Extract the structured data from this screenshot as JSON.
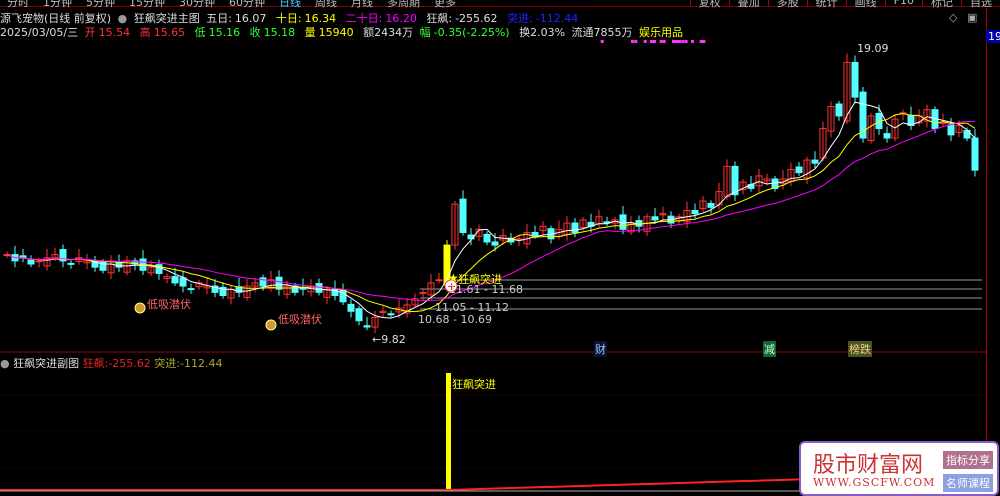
{
  "toolbar": {
    "tabs": [
      "分时",
      "1分钟",
      "5分钟",
      "15分钟",
      "30分钟",
      "60分钟",
      "日线",
      "周线",
      "月线",
      "多周期",
      "更多"
    ],
    "active": "日线",
    "right": [
      "复权",
      "叠加",
      "多股",
      "统计",
      "画线",
      "F10",
      "标记",
      "自选"
    ]
  },
  "header": {
    "stock": "源飞宠物(日线 前复权)",
    "indicator": "狂飙突进主图",
    "ma5_label": "五日:",
    "ma5": "16.07",
    "ma10_label": "十日:",
    "ma10": "16.34",
    "ma20_label": "二十日:",
    "ma20": "16.20",
    "kb_label": "狂飙:",
    "kb": "-255.62",
    "tj_label": "突进:",
    "tj": "-112.44"
  },
  "quote": {
    "date": "2025/03/05/三",
    "open_l": "开",
    "open": "15.54",
    "high_l": "高",
    "high": "15.65",
    "low_l": "低",
    "low": "15.16",
    "close_l": "收",
    "close": "15.18",
    "vol_l": "量",
    "vol": "15940",
    "amt": "额2434万",
    "chg_l": "幅",
    "chg": "-0.35(-2.25%)",
    "turn": "换2.03%",
    "float": "流通7855万",
    "sector": "娱乐用品"
  },
  "axis": {
    "top_price": "19.0"
  },
  "annotations": {
    "high": "19.09",
    "low": "←9.82",
    "signal": "狂飙突进",
    "r1": "11.61 - 11.68",
    "r2": "11.05 - 11.12",
    "r3": "10.68 - 10.69",
    "mark1": "低吸潜伏",
    "mark2": "低吸潜伏",
    "tag_cai": "财",
    "tag_jian": "减",
    "tag_bang": "榜跌"
  },
  "sub": {
    "title": "狂飙突进副图",
    "kb_label": "狂飙:",
    "kb": "-255.62",
    "tj_label": "突进:",
    "tj": "-112.44",
    "signal": "狂飙突进"
  },
  "watermark": {
    "title": "股市财富网",
    "url": "WWW.GSCFW.COM",
    "b1": "指标分享",
    "b2": "名师课程"
  },
  "colors": {
    "up": "#ff3232",
    "down": "#54ffff",
    "ma5": "#ffffff",
    "ma10": "#ffff00",
    "ma20": "#ff00ff"
  },
  "chart_data": {
    "type": "candlestick",
    "price_range": [
      9.82,
      19.09
    ],
    "closes": [
      12.5,
      12.3,
      12.4,
      12.2,
      12.3,
      12.4,
      12.5,
      12.3,
      12.2,
      12.4,
      12.3,
      12.1,
      12.0,
      12.2,
      12.1,
      12.3,
      12.2,
      12.0,
      12.1,
      11.9,
      11.8,
      11.6,
      11.5,
      11.4,
      11.6,
      11.5,
      11.3,
      11.2,
      11.4,
      11.3,
      11.5,
      11.6,
      11.5,
      11.7,
      11.4,
      11.5,
      11.3,
      11.4,
      11.5,
      11.3,
      11.4,
      11.2,
      11.0,
      10.7,
      10.4,
      10.2,
      10.5,
      10.7,
      10.6,
      10.8,
      10.9,
      11.1,
      11.3,
      11.6,
      11.7,
      12.8,
      14.1,
      13.2,
      13.0,
      13.3,
      12.9,
      12.8,
      13.1,
      12.9,
      13.0,
      13.2,
      13.1,
      13.4,
      13.0,
      13.3,
      13.5,
      13.2,
      13.6,
      13.4,
      13.7,
      13.5,
      13.6,
      13.3,
      13.5,
      13.4,
      13.7,
      13.6,
      13.8,
      13.5,
      13.7,
      13.9,
      13.8,
      14.2,
      14.0,
      14.5,
      15.3,
      14.4,
      14.8,
      14.6,
      15.0,
      14.9,
      14.6,
      14.9,
      15.2,
      15.1,
      15.5,
      15.4,
      16.5,
      17.2,
      16.9,
      18.6,
      17.5,
      16.2,
      16.9,
      16.5,
      16.2,
      16.8,
      17.0,
      16.6,
      16.9,
      17.1,
      16.5,
      16.7,
      16.3,
      16.6,
      16.2,
      15.18
    ]
  }
}
